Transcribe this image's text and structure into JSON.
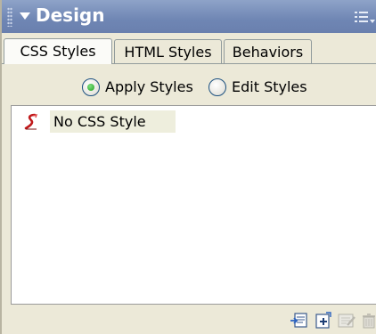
{
  "panel": {
    "title": "Design",
    "tabs": [
      {
        "label": "CSS Styles",
        "active": true
      },
      {
        "label": "HTML Styles",
        "active": false
      },
      {
        "label": "Behaviors",
        "active": false
      }
    ],
    "radio_options": [
      {
        "label": "Apply Styles",
        "selected": true
      },
      {
        "label": "Edit Styles",
        "selected": false
      }
    ],
    "styles_list": [
      {
        "label": "No CSS Style",
        "icon": "no-style-icon"
      }
    ],
    "toolbar_icons": [
      "attach-style-sheet-icon",
      "new-css-style-icon",
      "edit-style-sheet-icon",
      "delete-style-icon"
    ]
  },
  "colors": {
    "header_blue": "#6f86b4",
    "panel_bg": "#ece9d8",
    "selected_item_bg": "#eeeedd",
    "radio_selected": "#21a121"
  }
}
